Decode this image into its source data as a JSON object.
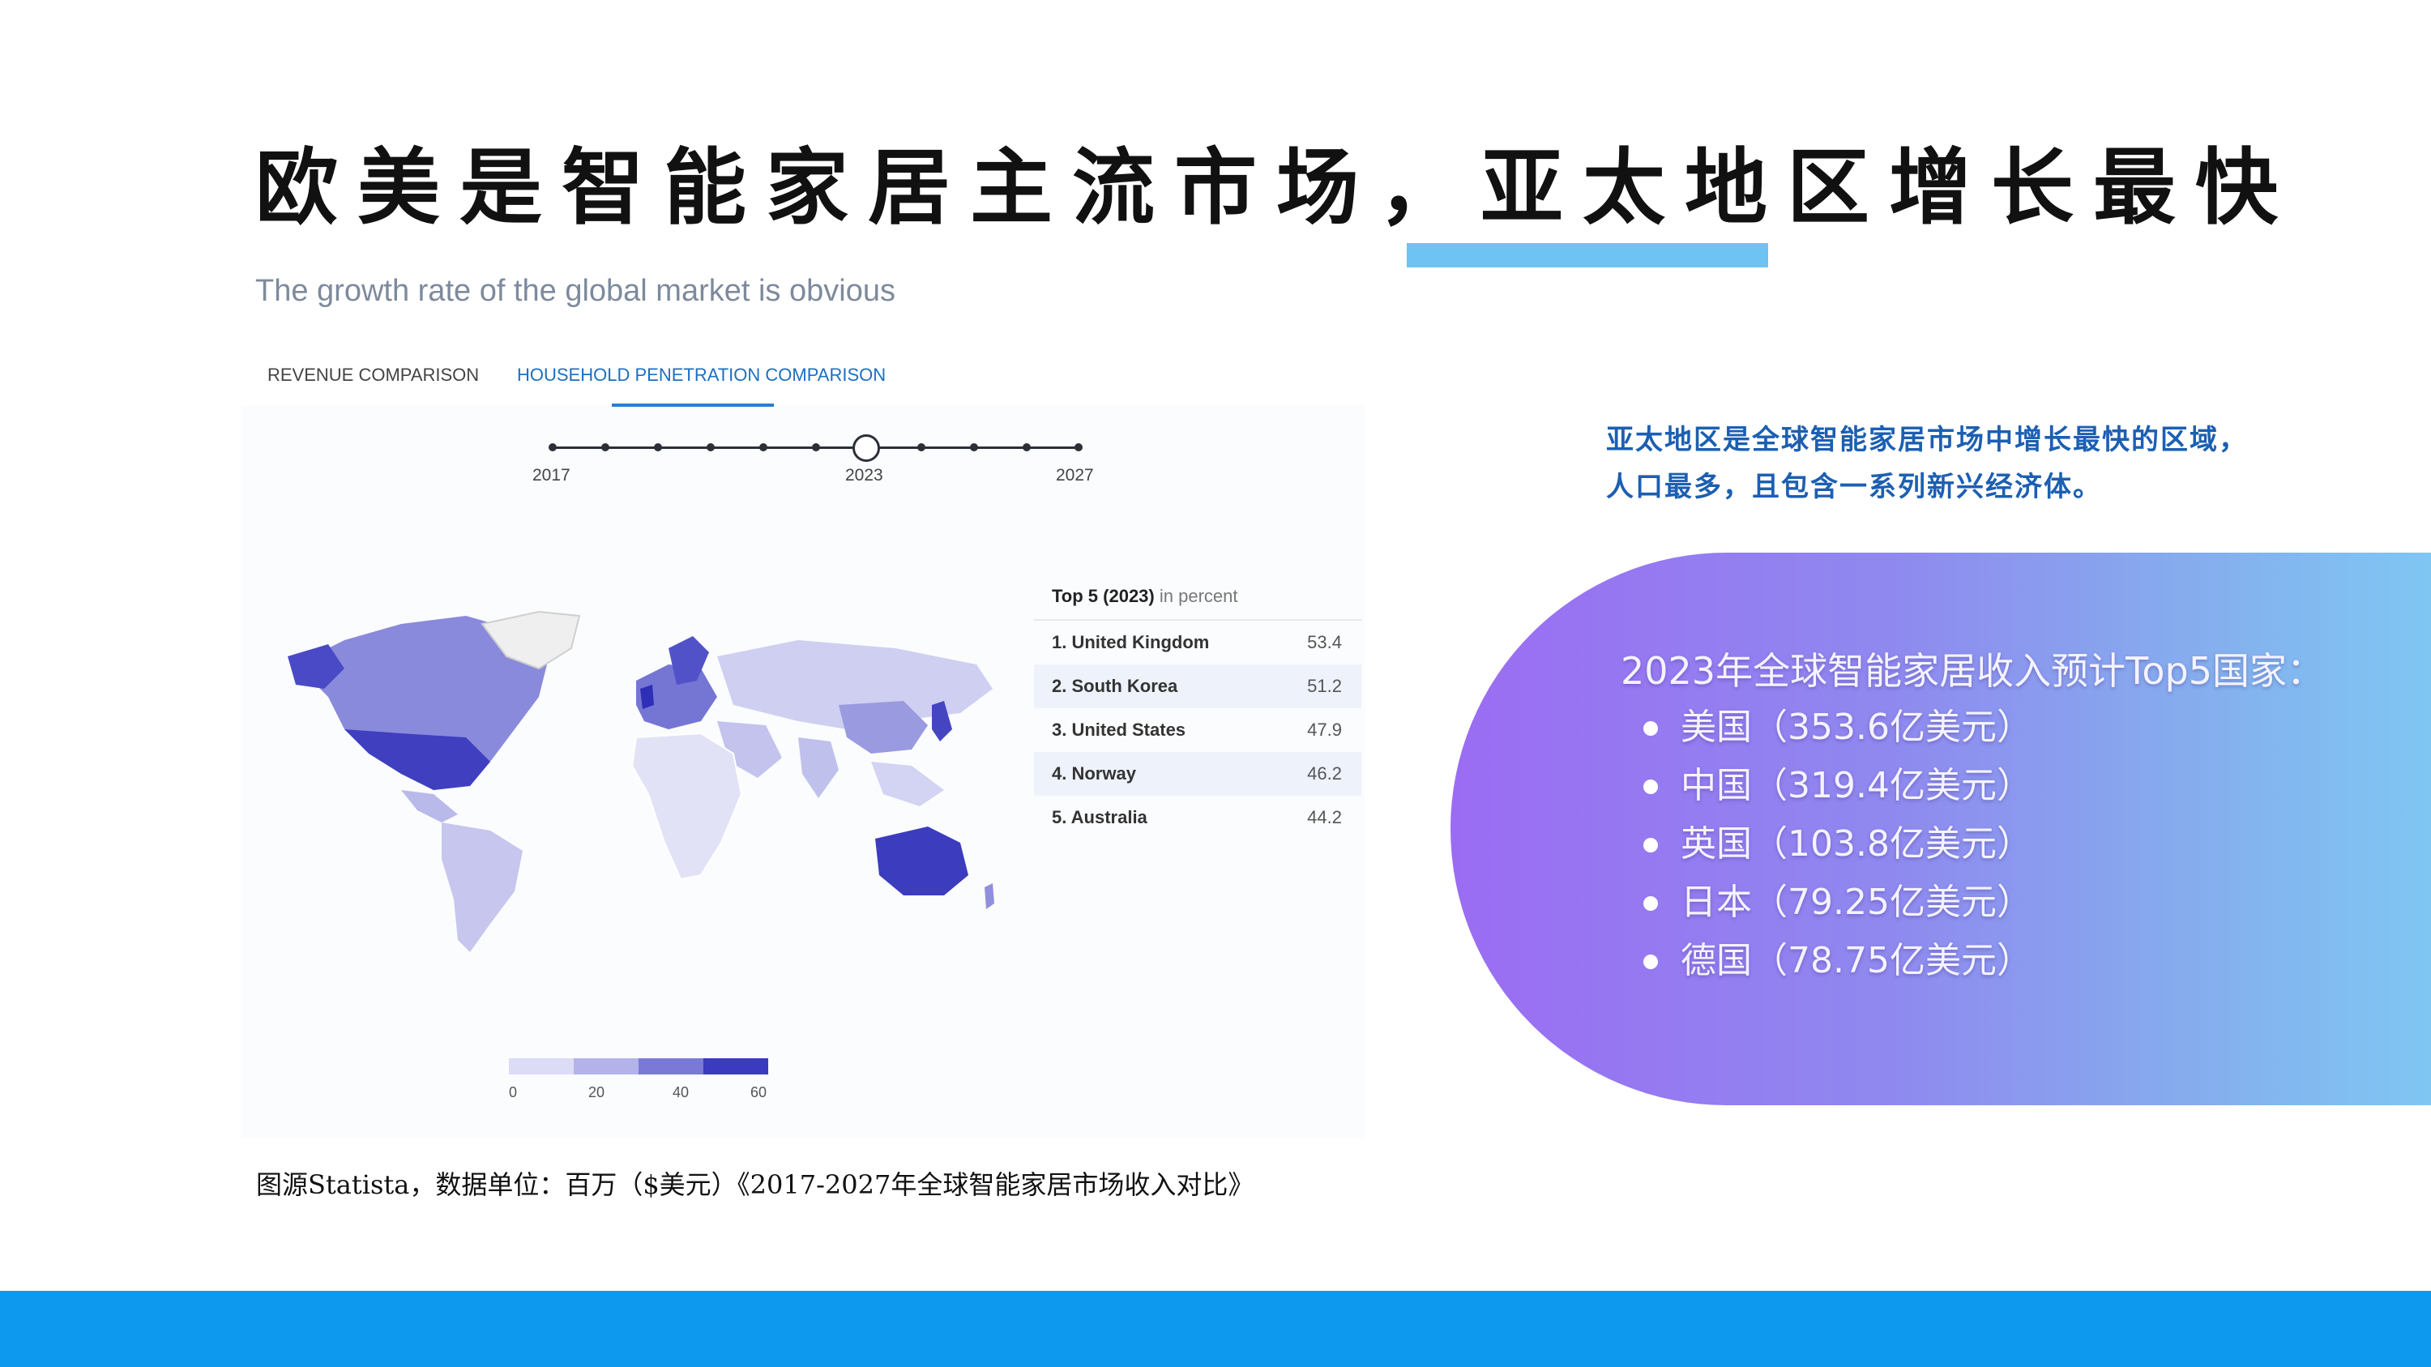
{
  "title": "欧美是智能家居主流市场，亚太地区增长最快",
  "subtitle": "The growth rate of the global market is obvious",
  "tabs": [
    {
      "label": "REVENUE COMPARISON"
    },
    {
      "label": "HOUSEHOLD PENETRATION COMPARISON",
      "active": true
    }
  ],
  "timeline": {
    "start": "2017",
    "selected": "2023",
    "end": "2027"
  },
  "top5": {
    "heading": "Top 5 (2023)",
    "unit": "in percent",
    "rows": [
      {
        "name": "1. United Kingdom",
        "value": "53.4"
      },
      {
        "name": "2. South Korea",
        "value": "51.2"
      },
      {
        "name": "3. United States",
        "value": "47.9"
      },
      {
        "name": "4. Norway",
        "value": "46.2"
      },
      {
        "name": "5. Australia",
        "value": "44.2"
      }
    ]
  },
  "legend": {
    "ticks": [
      "0",
      "20",
      "40",
      "60"
    ],
    "colors": [
      "#dcdcf6",
      "#b3b3ea",
      "#7a7ad6",
      "#3b3bbf"
    ]
  },
  "source": "图源Statista，数据单位：百万（$美元）《2017-2027年全球智能家居市场收入对比》",
  "intro": {
    "line1": "亚太地区是全球智能家居市场中增长最快的区域，",
    "line2": "人口最多，且包含一系列新兴经济体。"
  },
  "highlight": {
    "title": "2023年全球智能家居收入预计Top5国家：",
    "items": [
      "美国（353.6亿美元）",
      "中国（319.4亿美元）",
      "英国（103.8亿美元）",
      "日本（79.25亿美元）",
      "德国（78.75亿美元）"
    ]
  },
  "colors": {
    "accent": "#0d99ee",
    "underline": "#6fc3f2",
    "intro_text": "#1c5fb2",
    "gradient_start": "#9b6cf3",
    "gradient_end": "#7fc6f3"
  }
}
